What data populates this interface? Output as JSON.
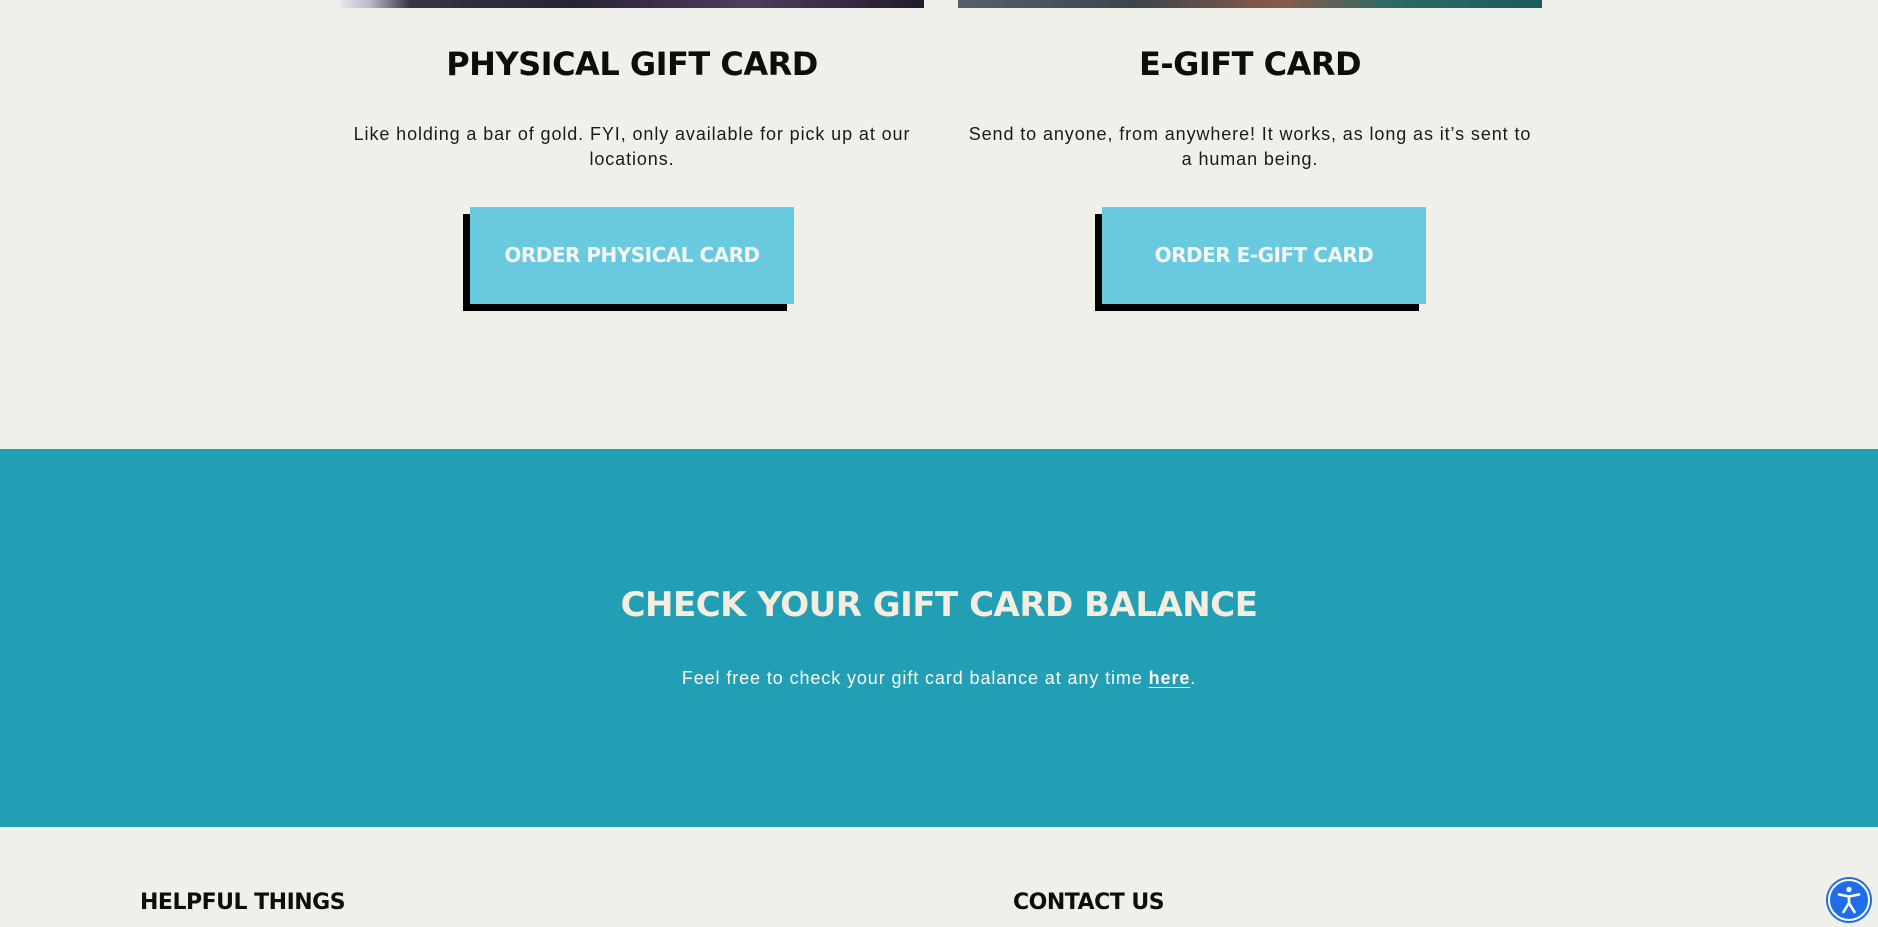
{
  "cards": {
    "physical": {
      "title": "PHYSICAL GIFT CARD",
      "description": "Like holding a bar of gold. FYI, only available for pick up at our locations.",
      "button_label": "ORDER PHYSICAL CARD"
    },
    "egift": {
      "title": "E-GIFT CARD",
      "description": "Send to anyone, from anywhere! It works, as long as it’s sent to a human being.",
      "button_label": "ORDER E-GIFT CARD"
    }
  },
  "balance": {
    "title": "CHECK YOUR GIFT CARD BALANCE",
    "text_before": "Feel free to check your gift card balance at any time ",
    "link_label": "here",
    "text_after": "."
  },
  "footer": {
    "helpful_heading": "HELPFUL THINGS",
    "contact_heading": "CONTACT US"
  },
  "accessibility": {
    "icon": "accessibility-icon"
  },
  "colors": {
    "page_background": "#f0f0eb",
    "button_background": "#69c9df",
    "band_background": "#239fb5",
    "accessibility_button": "#1f6ee8"
  }
}
